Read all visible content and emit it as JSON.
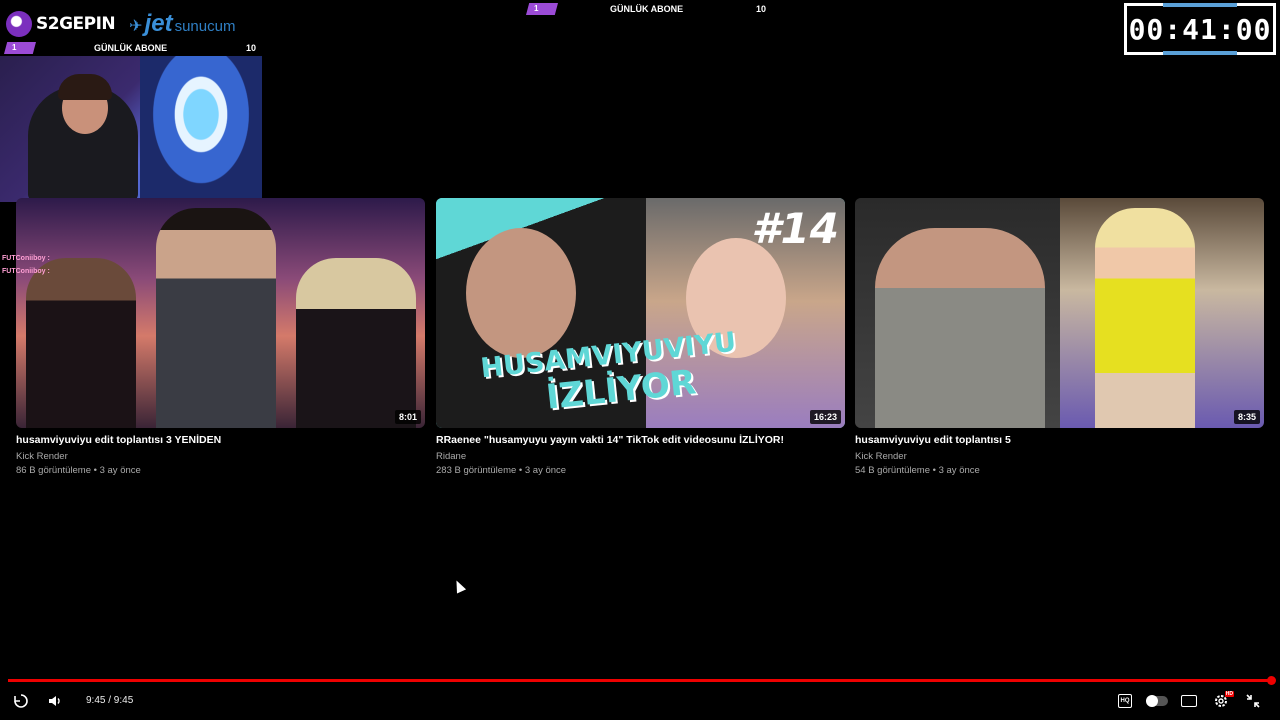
{
  "overlay": {
    "brand_s2": "S2GEPIN",
    "brand_jet_a": "jet",
    "brand_jet_b": "sunucum",
    "abone_left": {
      "rank": "1",
      "label": "GÜNLÜK ABONE",
      "count": "10"
    },
    "abone_center": {
      "rank": "1",
      "label": "GÜNLÜK ABONE",
      "count": "10"
    },
    "timer": "00:41:00",
    "chat_lines": [
      "FUTConiiboy :",
      "FUTConiiboy :"
    ]
  },
  "thumb_texts": {
    "thumb2_number": "#14",
    "thumb2_line1": "HUSAMVIYUVIYU",
    "thumb2_line2": "İZLİYOR"
  },
  "videos": [
    {
      "title": "husamviyuviyu edit toplantısı 3 YENİDEN",
      "channel": "Kick Render",
      "meta": "86 B görüntüleme • 3 ay önce",
      "duration": "8:01"
    },
    {
      "title": "RRaenee \"husamyuyu yayın vakti 14\" TikTok edit videosunu İZLİYOR!",
      "channel": "Ridane",
      "meta": "283 B görüntüleme • 3 ay önce",
      "duration": "16:23"
    },
    {
      "title": "husamviyuviyu edit toplantısı 5",
      "channel": "Kick Render",
      "meta": "54 B görüntüleme • 3 ay önce",
      "duration": "8:35"
    }
  ],
  "player": {
    "time": "9:45 / 9:45",
    "progress": 1.0,
    "hq_label": "HQ",
    "hd_badge": "HD",
    "icons": [
      "replay-icon",
      "volume-icon",
      "autoplay-toggle",
      "subtitles-icon",
      "settings-icon",
      "exit-fullscreen-icon"
    ],
    "accent_color": "#ee0000"
  }
}
